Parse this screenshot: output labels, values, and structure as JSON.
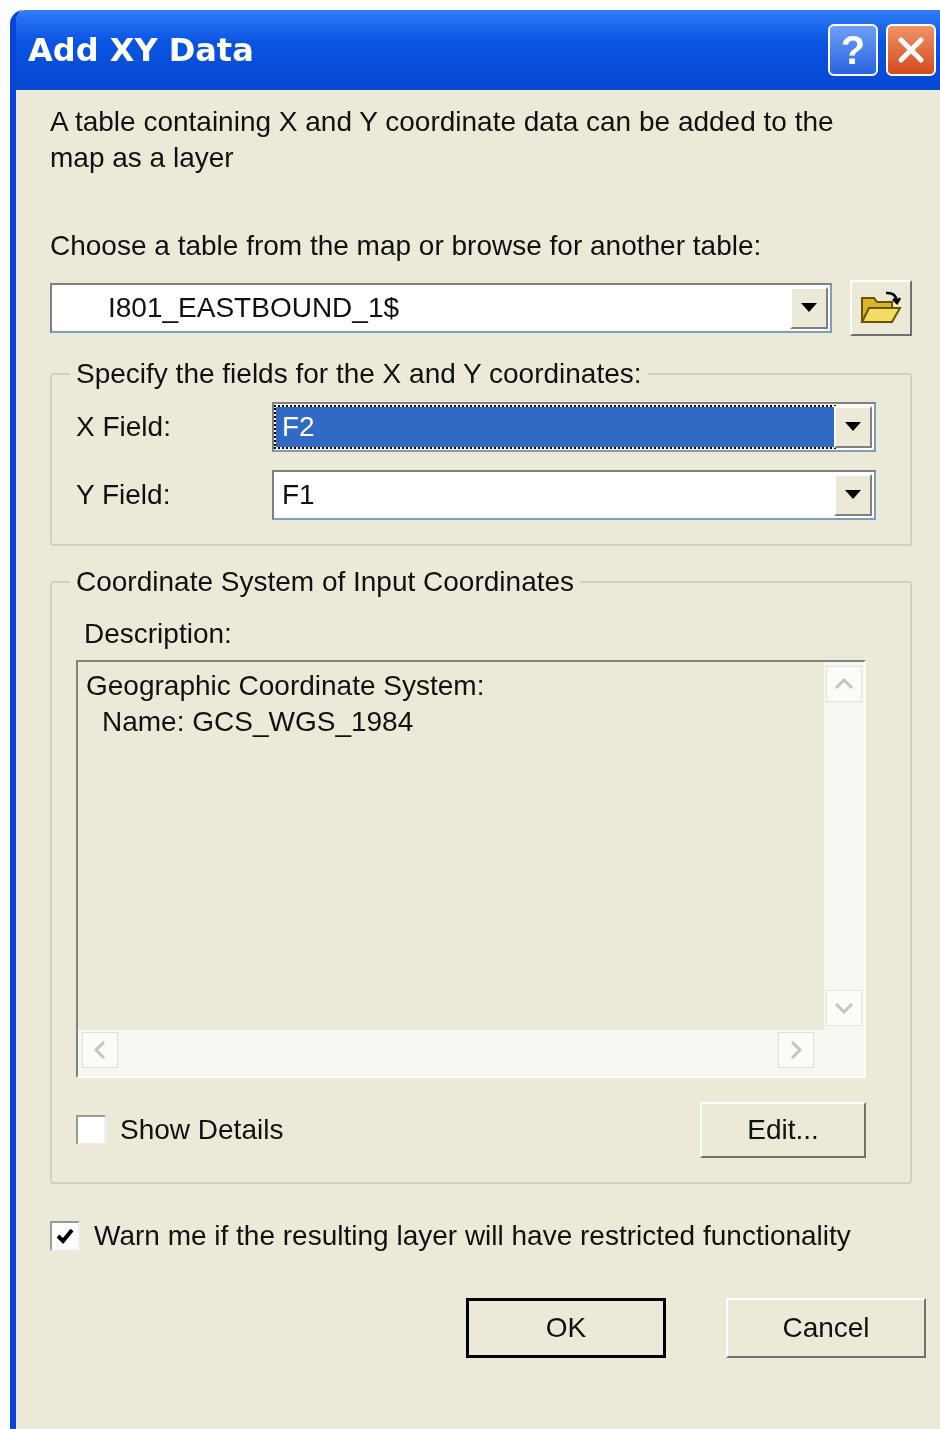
{
  "window": {
    "title": "Add XY Data",
    "help_button": "?"
  },
  "intro": "A table containing X and Y coordinate data can be added to the map as a layer",
  "table_label": "Choose a table from the map or browse for another table:",
  "table_combo": {
    "value": "I801_EASTBOUND_1$"
  },
  "fields_group": {
    "title": "Specify the fields for the X and Y coordinates:",
    "fields": [
      {
        "label": "X Field:",
        "value": "F2",
        "focused": true
      },
      {
        "label": "Y Field:",
        "value": "F1",
        "focused": false
      }
    ]
  },
  "coordinate_group": {
    "title": "Coordinate System of Input Coordinates",
    "description_label": "Description:",
    "description": [
      {
        "text": "Geographic Coordinate System:",
        "children": [
          {
            "text": "Name: GCS_WGS_1984"
          }
        ]
      }
    ],
    "show_details": {
      "label": "Show Details",
      "checked": false
    },
    "edit_button": "Edit..."
  },
  "warn": {
    "label": "Warn me if the resulting layer will have restricted functionality",
    "checked": true
  },
  "buttons": [
    {
      "label": "OK",
      "default": true
    },
    {
      "label": "Cancel",
      "default": false
    }
  ]
}
